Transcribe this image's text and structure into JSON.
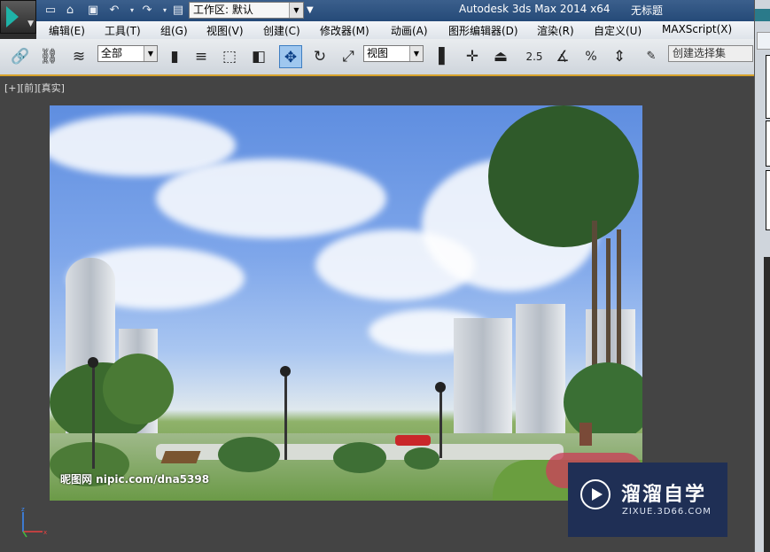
{
  "titlebar": {
    "app_title": "Autodesk 3ds Max  2014 x64",
    "doc_title": "无标题",
    "workspace_label": "工作区: 默认",
    "quick_access": [
      "new-icon",
      "open-icon",
      "save-icon",
      "undo-icon",
      "redo-icon",
      "project-icon"
    ]
  },
  "menu": {
    "items": [
      "编辑(E)",
      "工具(T)",
      "组(G)",
      "视图(V)",
      "创建(C)",
      "修改器(M)",
      "动画(A)",
      "图形编辑器(D)",
      "渲染(R)",
      "自定义(U)",
      "MAXScript(X)"
    ]
  },
  "toolbar": {
    "selection_filter": "全部",
    "ref_coord": "视图",
    "named_selection_placeholder": "创建选择集",
    "snap_label": "2.5",
    "percent_label": "%"
  },
  "viewport": {
    "label": "[+][前][真实]",
    "image_watermark": "昵图网 nipic.com/dna5398"
  },
  "watermark": {
    "brand": "溜溜自学",
    "url": "ZIXUE.3D66.COM"
  },
  "colors": {
    "titlebar": "#254a78",
    "active_tool": "#9fc7ef",
    "viewport_border": "#d7a22b",
    "watermark_bg": "#1f2f55"
  }
}
